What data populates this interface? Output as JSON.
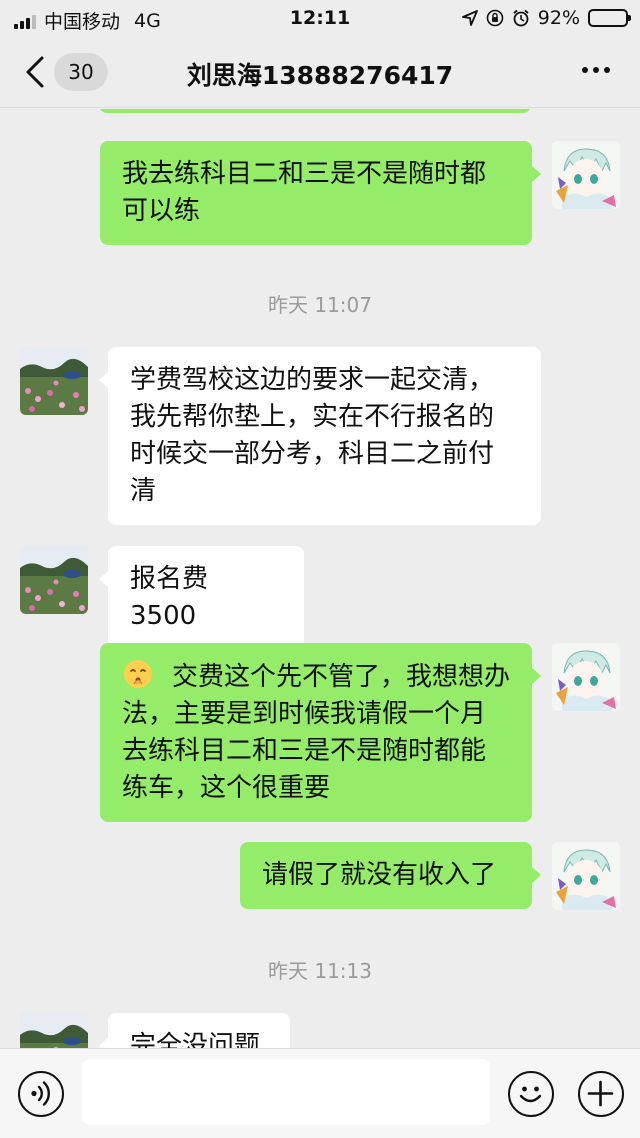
{
  "status_bar": {
    "carrier": "中国移动",
    "network": "4G",
    "time": "12:11",
    "battery_text": "92%",
    "battery_level": 0.92
  },
  "nav": {
    "back_icon": "chevron-left-icon",
    "unread_count": "30",
    "title": "刘思海13888276417",
    "more_icon": "ellipsis-icon"
  },
  "messages": [
    {
      "side": "right",
      "text": "我去练科目二和三是不是随时都可以练"
    },
    {
      "side": "time",
      "text": "昨天 11:07"
    },
    {
      "side": "left",
      "text": "学费驾校这边的要求一起交清，我先帮你垫上，实在不行报名的时候交一部分考，科目二之前付清"
    },
    {
      "side": "left",
      "text": "报名费 3500"
    },
    {
      "side": "right",
      "emoji": "shushing-face",
      "text": "交费这个先不管了，我想想办法，主要是到时候我请假一个月去练科目二和三是不是随时都能练车，这个很重要"
    },
    {
      "side": "right",
      "text": "请假了就没有收入了"
    },
    {
      "side": "time",
      "text": "昨天 11:13"
    },
    {
      "side": "left",
      "text": "完全没问题"
    }
  ],
  "input_bar": {
    "voice_icon": "voice-icon",
    "input_value": "",
    "emoji_icon": "emoji-icon",
    "plus_icon": "plus-icon"
  },
  "colors": {
    "background": "#ededed",
    "bubble_self": "#95ec69",
    "bubble_other": "#ffffff",
    "timestamp": "#9b9b9b"
  }
}
